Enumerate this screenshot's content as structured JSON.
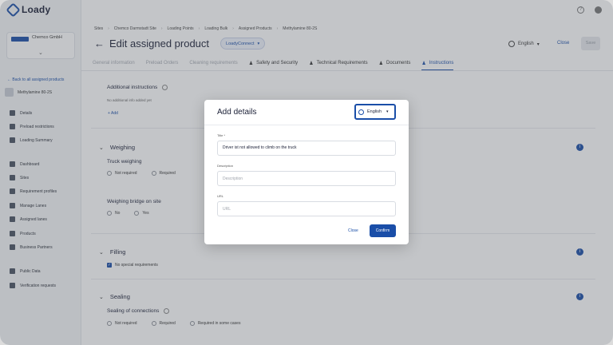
{
  "app": {
    "logo": "Loady"
  },
  "sidebar": {
    "company": "Chemco GmbH",
    "back_link": "← Back to all assigned products",
    "product": "Methylamine 80-2S",
    "items": [
      {
        "label": "Details",
        "icon": "box-icon"
      },
      {
        "label": "Preload restrictions",
        "icon": "doc-icon"
      },
      {
        "label": "Loading Summary",
        "icon": "box-icon"
      },
      {
        "label": "Dashboard",
        "icon": "grid-icon"
      },
      {
        "label": "Sites",
        "icon": "building-icon"
      },
      {
        "label": "Requirement profiles",
        "icon": "doc-icon"
      },
      {
        "label": "Manage Lanes",
        "icon": "lanes-icon"
      },
      {
        "label": "Assigned lanes",
        "icon": "person-plus-icon"
      },
      {
        "label": "Products",
        "icon": "box-icon"
      },
      {
        "label": "Business Partners",
        "icon": "building-icon"
      },
      {
        "label": "Public Data",
        "icon": "table-icon"
      },
      {
        "label": "Verification requests",
        "icon": "doc-icon"
      }
    ]
  },
  "header": {
    "breadcrumb": [
      "Sites",
      "Chemco Darmstadt Site",
      "Loading Points",
      "Loading Bulk",
      "Assigned Products",
      "Methylamine 80-2S"
    ],
    "title": "Edit assigned product",
    "connect": "LoadyConnect",
    "language": "English",
    "close": "Close",
    "save": "Save"
  },
  "tabs": [
    {
      "label": "General information",
      "muted": true
    },
    {
      "label": "Preload Orders",
      "muted": true
    },
    {
      "label": "Cleaning requirements",
      "muted": true
    },
    {
      "label": "Safety and Security"
    },
    {
      "label": "Technical Requirements"
    },
    {
      "label": "Documents"
    },
    {
      "label": "Instructions",
      "active": true
    }
  ],
  "content": {
    "additional_instructions": "Additional instructions",
    "no_instructions": "No additional info added yet",
    "add": "+ Add",
    "weighing": {
      "title": "Weighing",
      "truck_weighing": "Truck weighing",
      "truck_options": [
        "Not required",
        "Required"
      ],
      "bridge": "Weighing bridge on site",
      "bridge_options": [
        "No",
        "Yes"
      ]
    },
    "filling": {
      "title": "Filling",
      "option": "No special requirements"
    },
    "sealing": {
      "title": "Sealing",
      "connections": "Sealing of connections",
      "options": [
        "Not required",
        "Required",
        "Required in some cases"
      ]
    }
  },
  "modal": {
    "title": "Add details",
    "language": "English",
    "title_label": "Title *",
    "title_value": "Driver ist not allowed to climb on the truck",
    "description_label": "Description",
    "description_placeholder": "Description",
    "url_label": "URL",
    "url_placeholder": "URL",
    "close": "Close",
    "confirm": "Confirm"
  }
}
